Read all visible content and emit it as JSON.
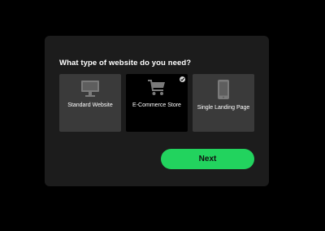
{
  "wizard": {
    "question": "What type of website do you need?",
    "options": [
      {
        "label": "Standard Website",
        "icon": "monitor-icon",
        "selected": false
      },
      {
        "label": "E-Commerce Store",
        "icon": "shopping-cart-icon",
        "selected": true
      },
      {
        "label": "Single Landing Page",
        "icon": "tablet-icon",
        "selected": false
      }
    ],
    "next_label": "Next",
    "colors": {
      "accent": "#22d35e",
      "card": "#1c1c1c",
      "option": "#3a3a3a",
      "option_selected": "#000000",
      "icon": "#7a7a7a"
    }
  }
}
